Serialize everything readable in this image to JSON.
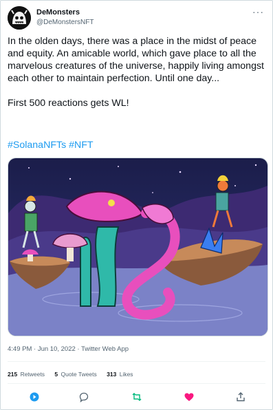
{
  "tweet": {
    "author_name": "DeMonsters",
    "author_handle": "@DeMonstersNFT",
    "text": "In the olden days, there was a place in the midst of peace and equity. An amicable world, which gave place to all the marvelous creatures of the universe, happily living amongst each other to maintain perfection. Until one day...\n\nFirst 500 reactions gets WL!",
    "hashtags": [
      "#SolanaNFTs",
      "#NFT"
    ],
    "timestamp": "4:49 PM · Jun 10, 2022 · Twitter Web App"
  },
  "stats": {
    "retweets_count": "215",
    "retweets_label": "Retweets",
    "quotes_count": "5",
    "quotes_label": "Quote Tweets",
    "likes_count": "313",
    "likes_label": "Likes"
  },
  "actions": {
    "icons": [
      "reply-icon",
      "retweet-icon",
      "like-icon",
      "share-icon"
    ]
  },
  "colors": {
    "link": "#1d9bf0",
    "retweet": "#00ba7c",
    "like": "#f91880",
    "muted": "#536471"
  }
}
